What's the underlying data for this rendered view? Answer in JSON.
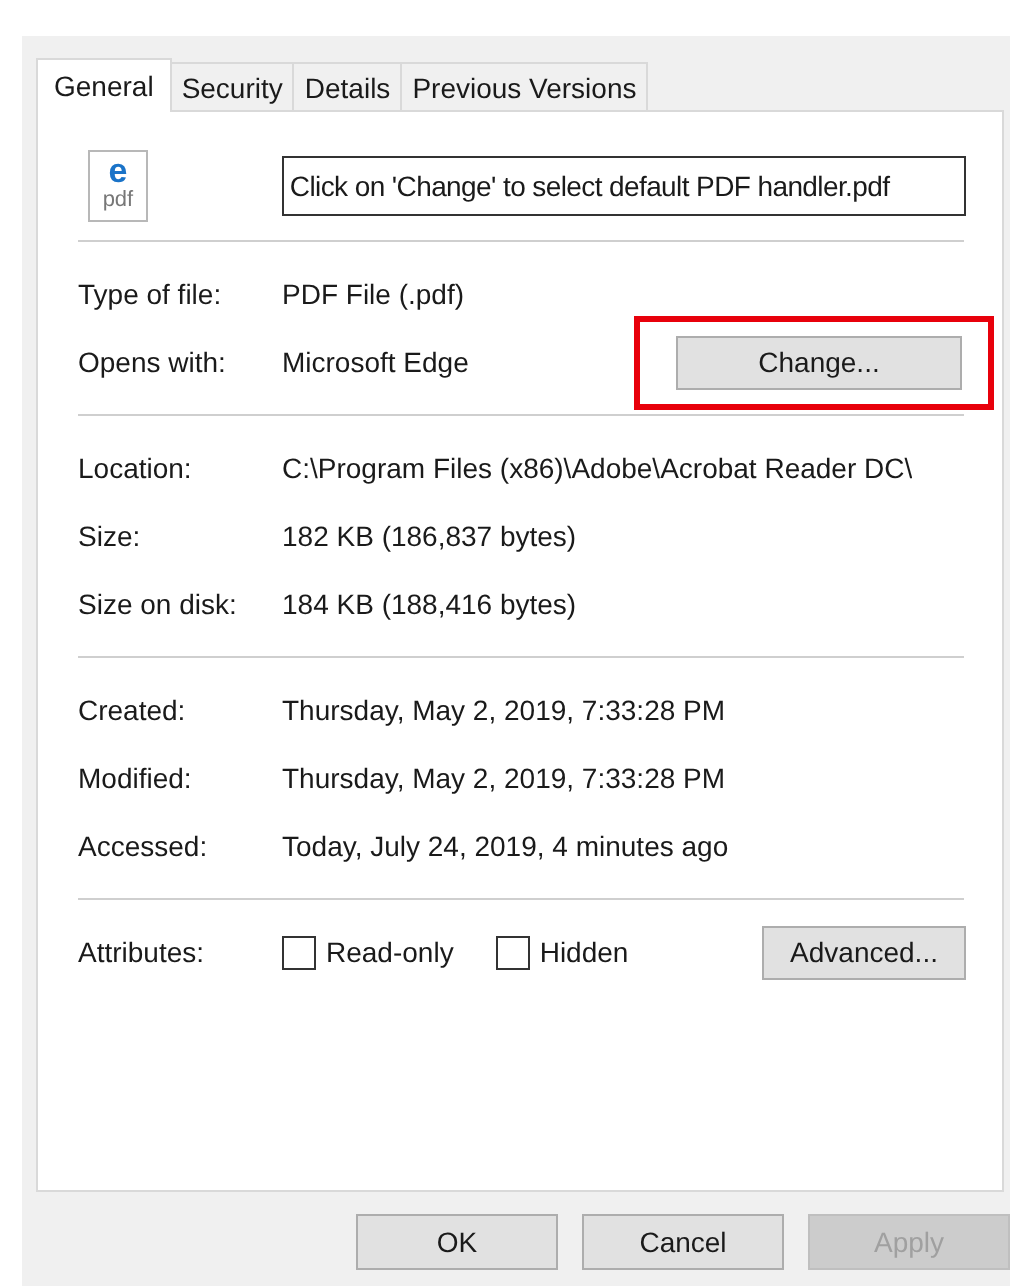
{
  "tabs": [
    {
      "label": "General",
      "selected": true
    },
    {
      "label": "Security",
      "selected": false
    },
    {
      "label": "Details",
      "selected": false
    },
    {
      "label": "Previous Versions",
      "selected": false
    }
  ],
  "file_icon": {
    "letter": "e",
    "caption": "pdf"
  },
  "file_name": "Click on 'Change' to select default PDF handler.pdf",
  "type_section": [
    {
      "label": "Type of file:",
      "value": "PDF File (.pdf)"
    },
    {
      "label": "Opens with:",
      "value": "Microsoft Edge",
      "button": {
        "label": "Change...",
        "highlighted": true
      }
    }
  ],
  "location_section": [
    {
      "label": "Location:",
      "value": "C:\\Program Files (x86)\\Adobe\\Acrobat Reader DC\\"
    },
    {
      "label": "Size:",
      "value": "182 KB (186,837 bytes)"
    },
    {
      "label": "Size on disk:",
      "value": "184 KB (188,416 bytes)"
    }
  ],
  "dates_section": [
    {
      "label": "Created:",
      "value": "Thursday, May 2, 2019, 7:33:28 PM"
    },
    {
      "label": "Modified:",
      "value": "Thursday, May 2, 2019, 7:33:28 PM"
    },
    {
      "label": "Accessed:",
      "value": "Today, July 24, 2019, 4 minutes ago"
    }
  ],
  "attributes": {
    "label": "Attributes:",
    "checkboxes": [
      {
        "label": "Read-only",
        "checked": false
      },
      {
        "label": "Hidden",
        "checked": false
      }
    ],
    "button": "Advanced..."
  },
  "footer_buttons": [
    {
      "label": "OK",
      "disabled": false
    },
    {
      "label": "Cancel",
      "disabled": false
    },
    {
      "label": "Apply",
      "disabled": true
    }
  ]
}
